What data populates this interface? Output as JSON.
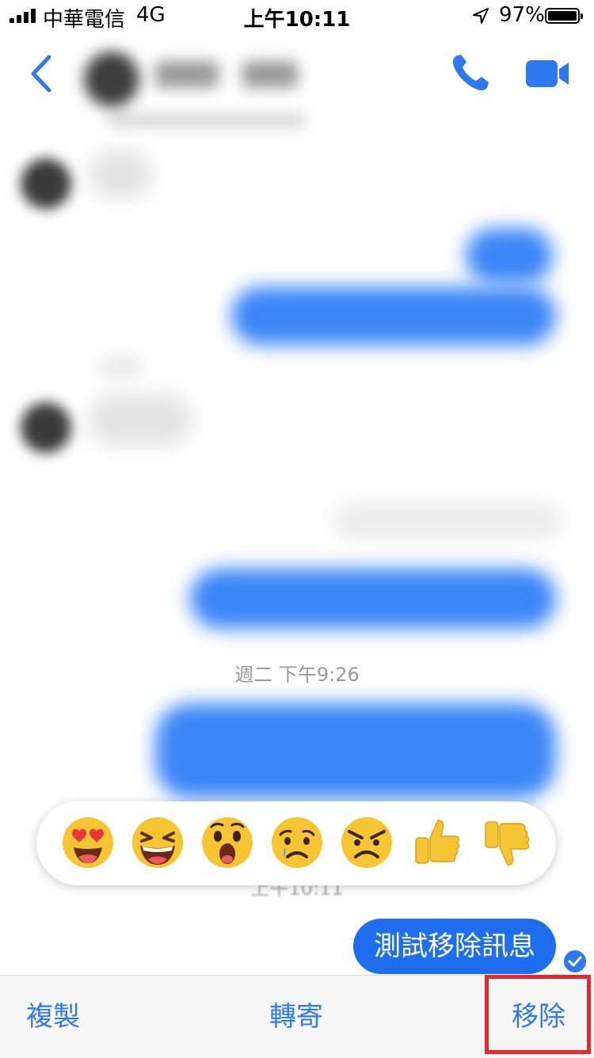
{
  "status_bar": {
    "carrier": "中華電信",
    "network": "4G",
    "time": "上午10:11",
    "battery_percent": "97%",
    "battery_level": 0.97,
    "signal_bars": 4
  },
  "header": {
    "back_icon": "chevron-left-icon",
    "call_icon": "phone-icon",
    "video_icon": "video-camera-icon"
  },
  "conversation": {
    "timestamp": "週二 下午9:26",
    "obscured_time": "上午10:11"
  },
  "reactions": [
    {
      "name": "heart-eyes-emoji"
    },
    {
      "name": "laughing-emoji"
    },
    {
      "name": "wow-emoji"
    },
    {
      "name": "sad-emoji"
    },
    {
      "name": "angry-emoji"
    },
    {
      "name": "thumbs-up-emoji"
    },
    {
      "name": "thumbs-down-emoji"
    }
  ],
  "message": {
    "text": "測試移除訊息",
    "status_icon": "seen-check-icon"
  },
  "actions": {
    "copy_label": "複製",
    "forward_label": "轉寄",
    "remove_label": "移除"
  },
  "colors": {
    "accent": "#2e78f0",
    "bubble": "#1e6ff0",
    "highlight": "#e8282e"
  }
}
